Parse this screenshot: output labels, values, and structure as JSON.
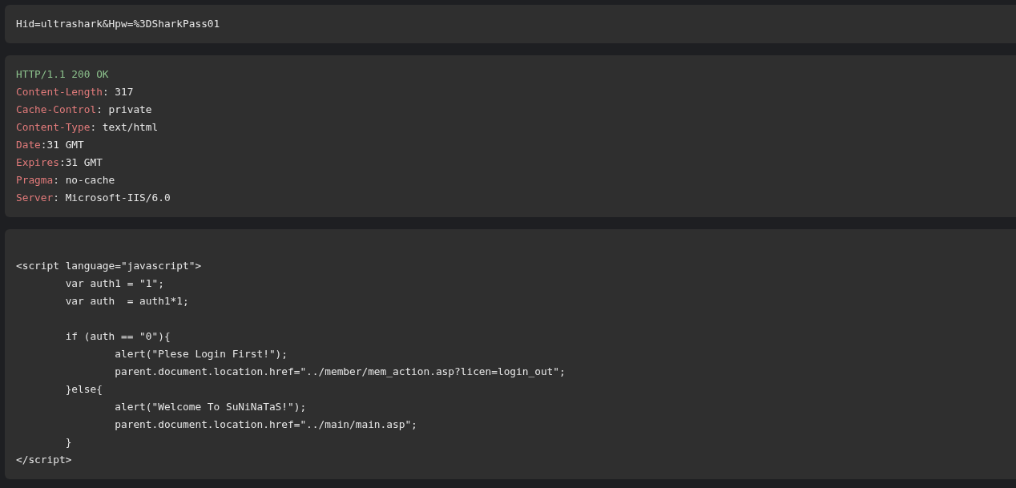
{
  "blocks": [
    {
      "lines": [
        {
          "kind": "text",
          "text": "Hid=ultrashark&Hpw=%3DSharkPass01"
        }
      ]
    },
    {
      "lines": [
        {
          "kind": "status",
          "text": "HTTP/1.1 200 OK"
        },
        {
          "kind": "header",
          "name": "Content-Length",
          "value": ": 317"
        },
        {
          "kind": "header",
          "name": "Cache-Control",
          "value": ": private"
        },
        {
          "kind": "header",
          "name": "Content-Type",
          "value": ": text/html"
        },
        {
          "kind": "header",
          "name": "Date",
          "value": ":31 GMT"
        },
        {
          "kind": "header",
          "name": "Expires",
          "value": ":31 GMT"
        },
        {
          "kind": "header",
          "name": "Pragma",
          "value": ": no-cache"
        },
        {
          "kind": "header",
          "name": "Server",
          "value": ": Microsoft-IIS/6.0"
        }
      ]
    },
    {
      "lines": [
        {
          "kind": "blank"
        },
        {
          "kind": "text",
          "text": "<script language=\"javascript\">"
        },
        {
          "kind": "text",
          "text": "\tvar auth1 = \"1\";"
        },
        {
          "kind": "text",
          "text": "\tvar auth  = auth1*1;"
        },
        {
          "kind": "blank"
        },
        {
          "kind": "text",
          "text": "\tif (auth == \"0\"){"
        },
        {
          "kind": "text",
          "text": "\t\talert(\"Plese Login First!\");"
        },
        {
          "kind": "text",
          "text": "\t\tparent.document.location.href=\"../member/mem_action.asp?licen=login_out\";"
        },
        {
          "kind": "text",
          "text": "\t}else{"
        },
        {
          "kind": "text",
          "text": "\t\talert(\"Welcome To SuNiNaTaS!\");"
        },
        {
          "kind": "text",
          "text": "\t\tparent.document.location.href=\"../main/main.asp\";"
        },
        {
          "kind": "text",
          "text": "\t}"
        },
        {
          "kind": "text",
          "text": "</script>"
        }
      ]
    }
  ]
}
